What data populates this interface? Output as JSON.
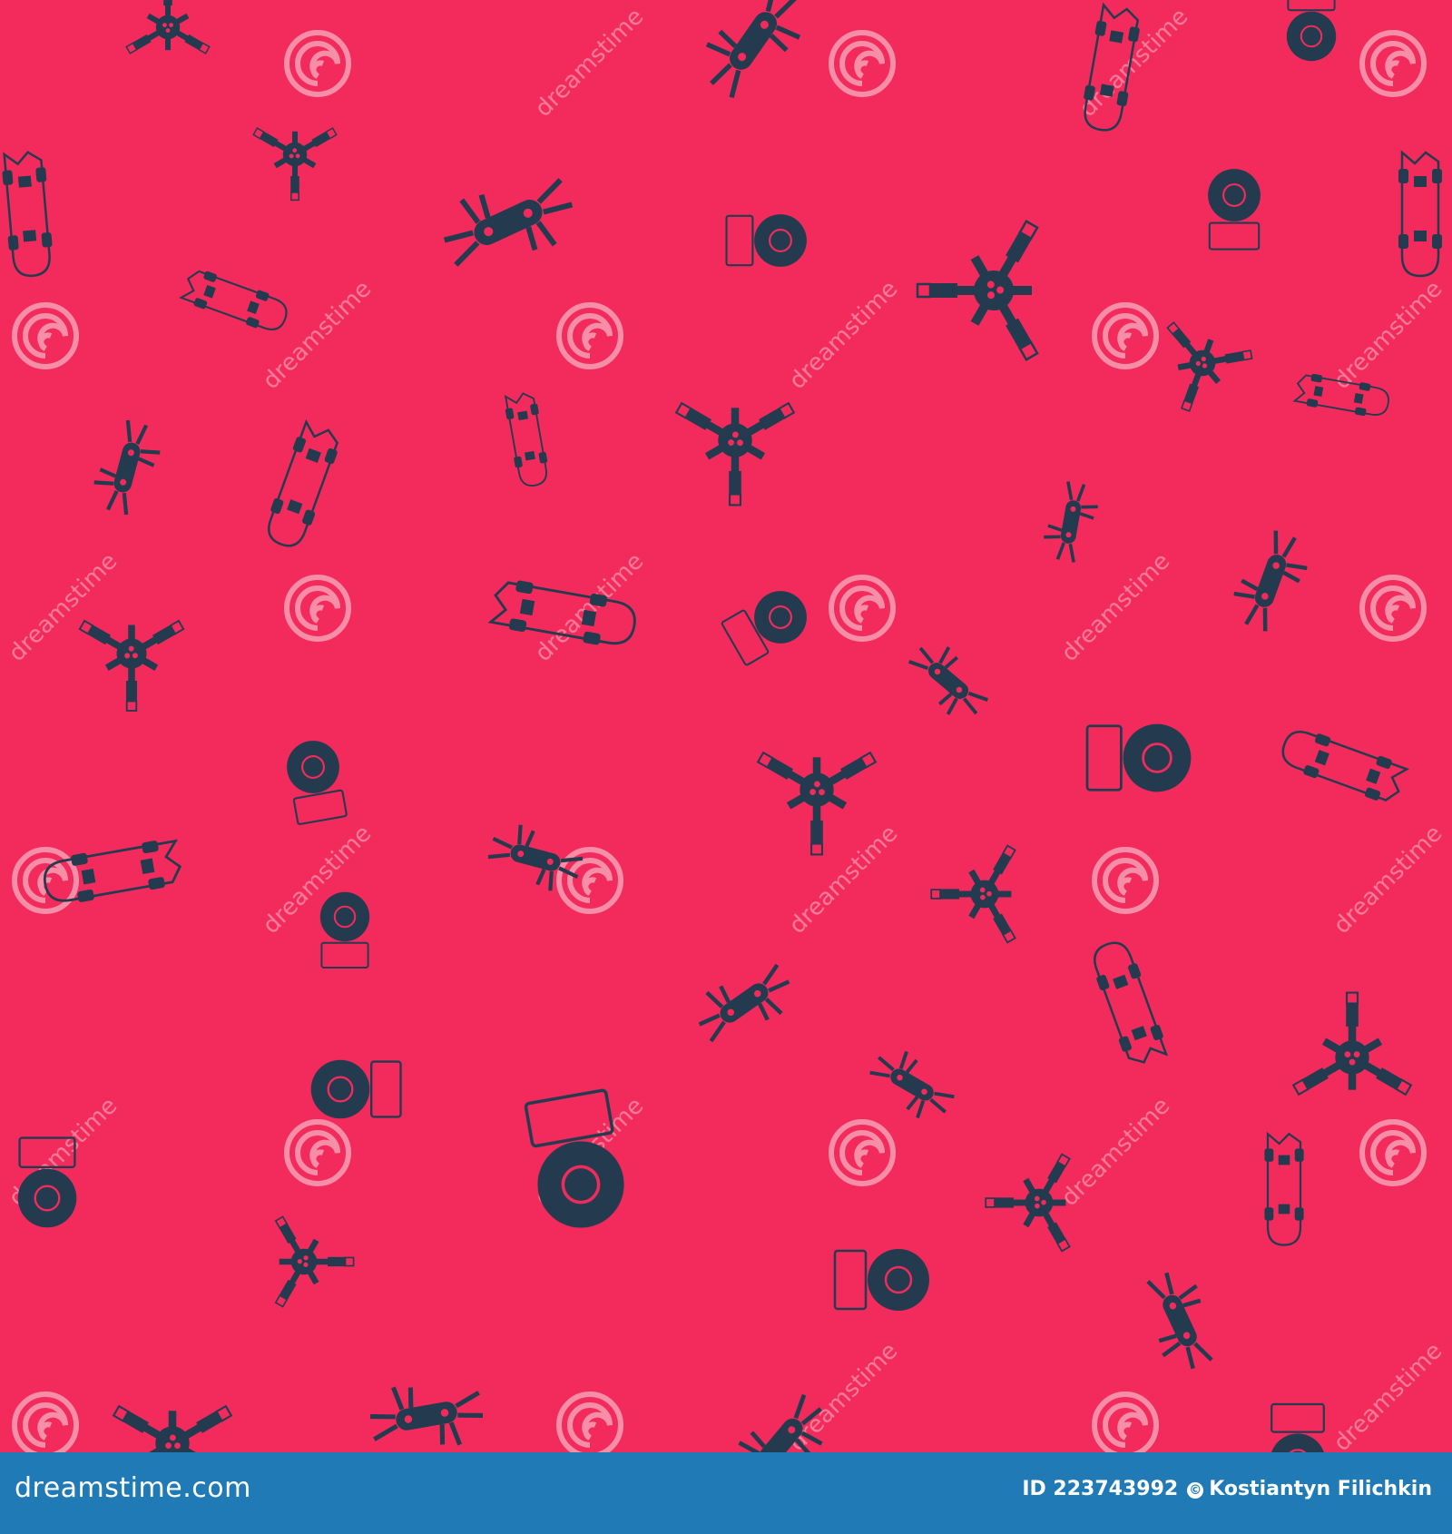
{
  "watermark": {
    "text": "dreamstime"
  },
  "colors": {
    "background": "#f32b5d",
    "icon": "#243b4f",
    "footer": "#1f7ab5",
    "swirl": "#f7a0b4"
  },
  "pattern_icons": [
    "skateboard-icon",
    "skateboard-wheel-icon",
    "skateboard-t-tool-icon",
    "multi-tool-icon"
  ],
  "footer": {
    "site": "dreamstime.com",
    "id_label": "ID 223743992",
    "author": "Kostiantyn Filichkin"
  }
}
